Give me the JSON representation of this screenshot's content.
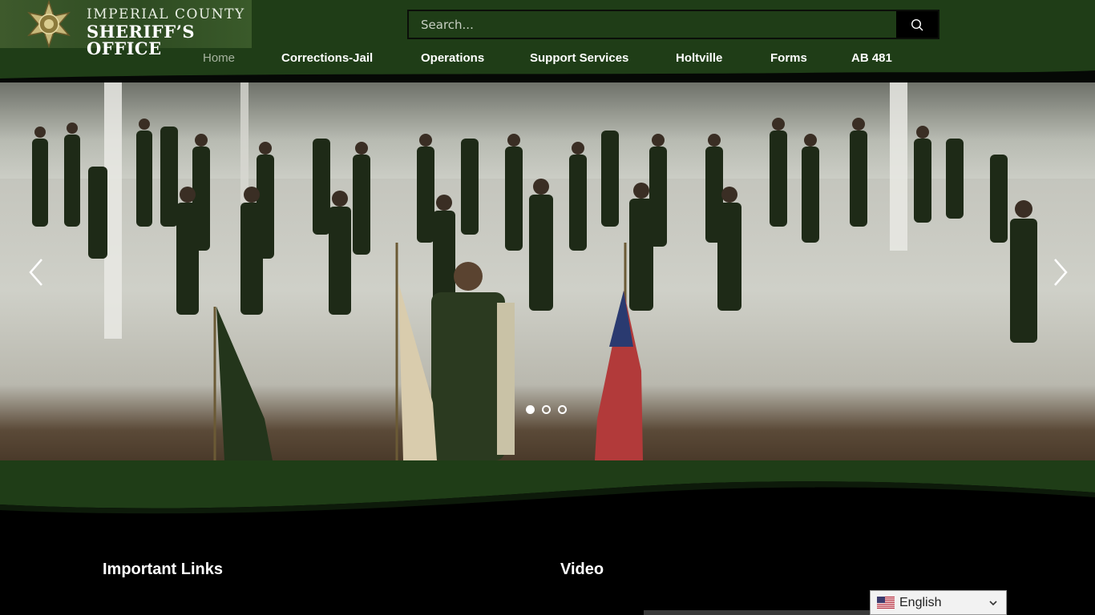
{
  "logo": {
    "line1": "IMPERIAL COUNTY",
    "line2": "SHERIFF’S OFFICE"
  },
  "search": {
    "placeholder": "Search..."
  },
  "nav": {
    "items": [
      {
        "label": "Home",
        "active": true
      },
      {
        "label": "Corrections-Jail"
      },
      {
        "label": "Operations"
      },
      {
        "label": "Support Services"
      },
      {
        "label": "Holtville"
      },
      {
        "label": "Forms"
      },
      {
        "label": "AB 481"
      }
    ]
  },
  "slider": {
    "slide_count": 3,
    "active_index": 0
  },
  "footer": {
    "important_links_title": "Important Links",
    "video_title": "Video"
  },
  "language": {
    "selected": "English",
    "flag_icon": "us-flag-icon"
  },
  "colors": {
    "header_green": "#1f3d17",
    "band_green": "#1f3d17",
    "background": "#000000"
  }
}
